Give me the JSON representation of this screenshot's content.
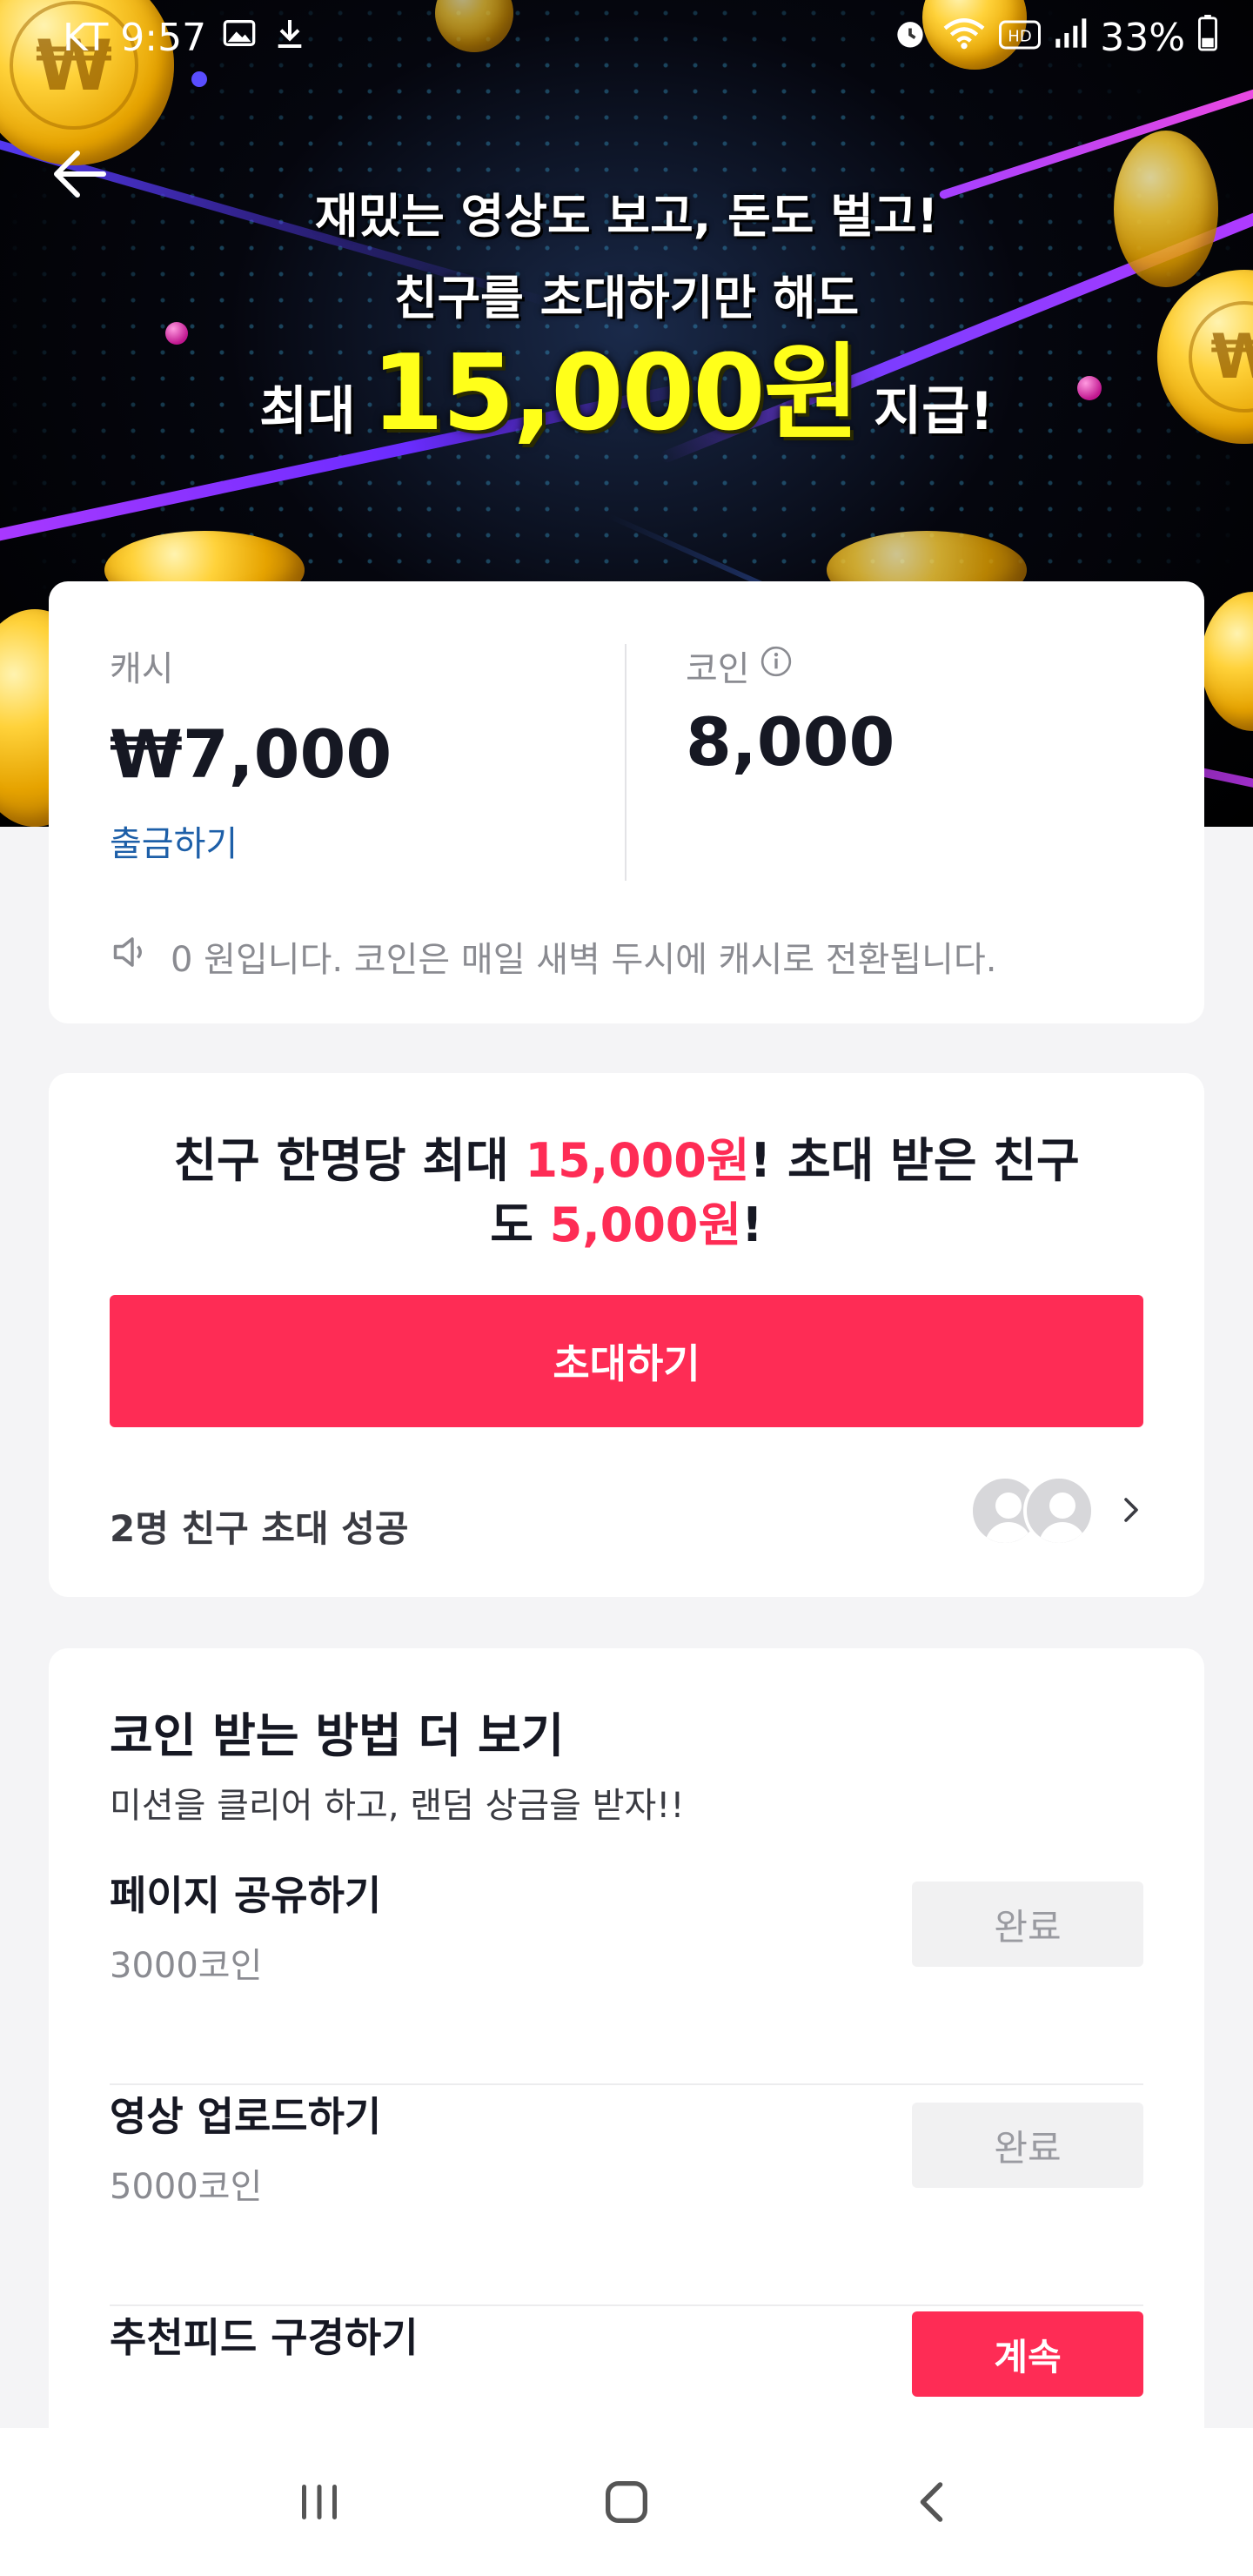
{
  "status_bar": {
    "carrier_time": "KT 9:57",
    "battery": "33%",
    "icons": [
      "image-icon",
      "download-icon",
      "alarm-icon",
      "wifi-icon",
      "hd-icon",
      "signal-icon",
      "battery-icon"
    ]
  },
  "banner": {
    "line1": "재밌는 영상도 보고, 돈도 벌고!",
    "line2": "친구를 초대하기만 해도",
    "line3_prefix": "최대",
    "line3_amount": "15,000원",
    "line3_suffix": "지급!"
  },
  "balance": {
    "cash_label": "캐시",
    "cash_value": "₩7,000",
    "withdraw_label": "출금하기",
    "coin_label": "코인",
    "coin_value": "8,000",
    "notice": "0 원입니다. 코인은 매일 새벽 두시에 캐시로 전환됩니다."
  },
  "invite": {
    "title_part1": "친구 한명당 최대 ",
    "title_amount1": "15,000원",
    "title_part2": "! 초대 받은 친구",
    "title_part3": "도 ",
    "title_amount2": "5,000원",
    "title_part4": "!",
    "button_label": "초대하기",
    "success_text": "2명 친구 초대 성공"
  },
  "missions": {
    "title": "코인 받는 방법 더 보기",
    "subtitle": "미션을 클리어 하고, 랜덤 상금을 받자!!",
    "tasks": [
      {
        "name": "페이지 공유하기",
        "reward": "3000코인",
        "button": "완료"
      },
      {
        "name": "영상 업로드하기",
        "reward": "5000코인",
        "button": "완료"
      },
      {
        "name": "추천피드 구경하기",
        "button": "계속"
      }
    ]
  },
  "colors": {
    "accent": "#fe2c55",
    "link": "#1d5fa8",
    "banner_highlight": "#ffff1a"
  }
}
